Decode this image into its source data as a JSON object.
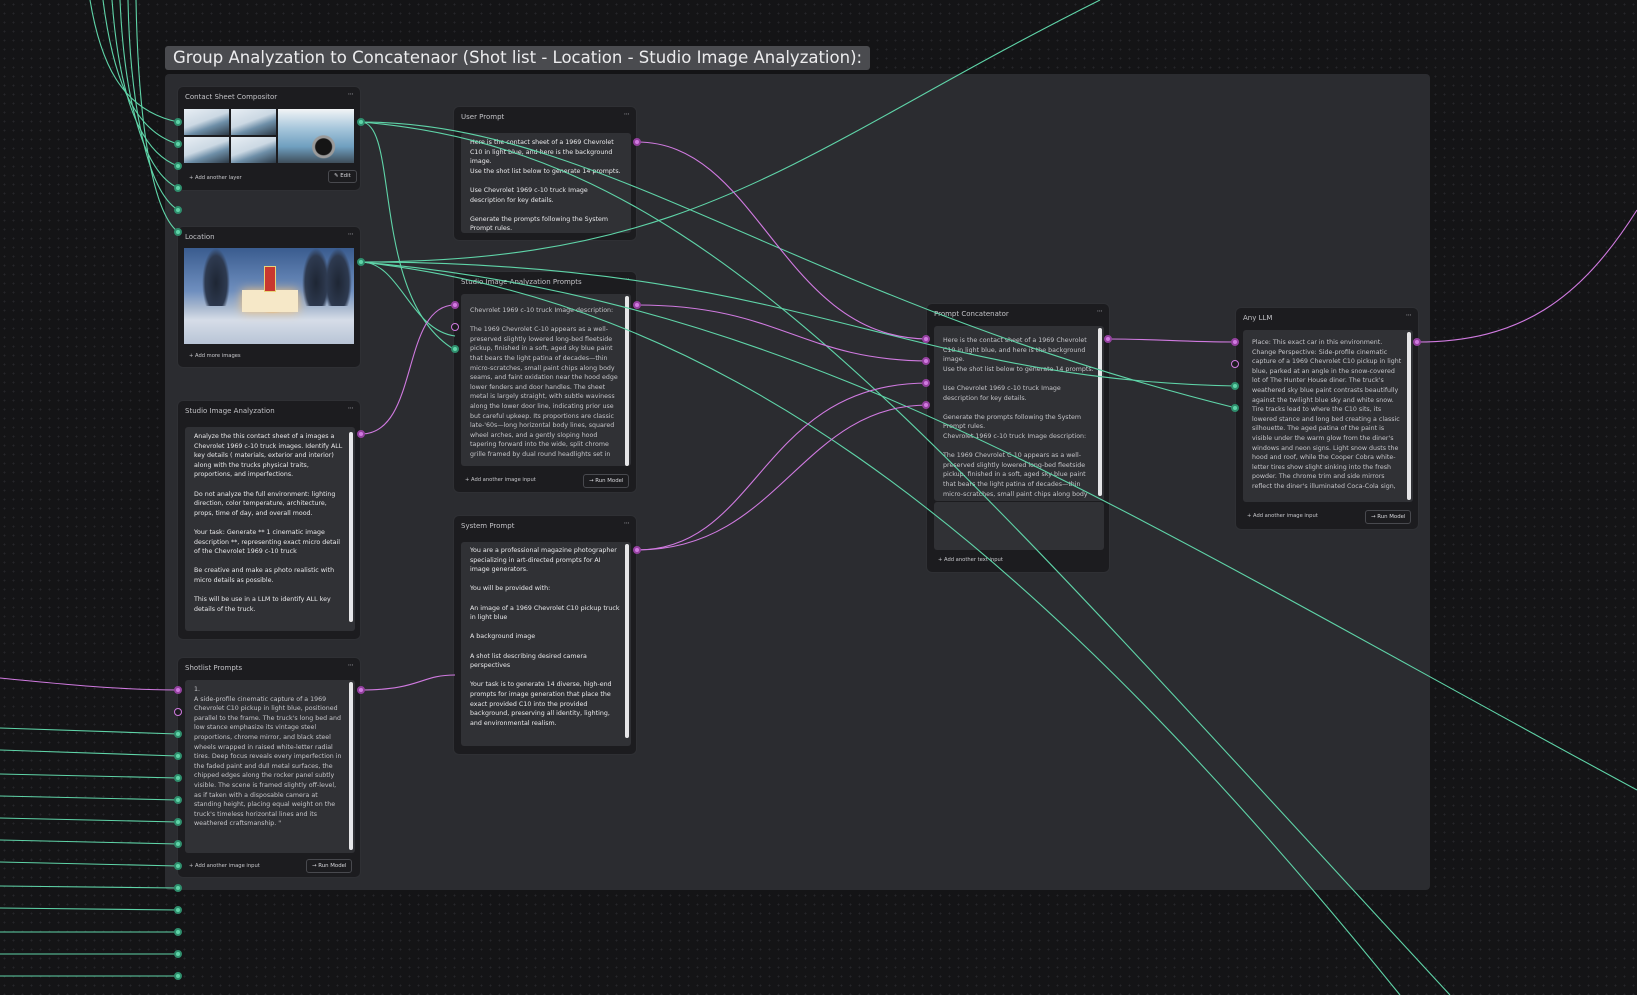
{
  "group": {
    "title": "Group Analyzation to Concatenaor (Shot list - Location - Studio Image Analyzation):"
  },
  "menu_glyph": "···",
  "colors": {
    "canvas": "#141416",
    "group_bg": "#2b2c30",
    "node_bg": "#1c1c1f",
    "wire_image": "#5fd4a8",
    "wire_text": "#d07ae0"
  },
  "nodes": {
    "contact_sheet": {
      "title": "Contact Sheet Compositor",
      "add_link": "+ Add another layer",
      "edit_button": "Edit",
      "edit_icon": "pencil-icon"
    },
    "location": {
      "title": "Location",
      "add_link": "+ Add more images"
    },
    "studio_analysis": {
      "title": "Studio Image Analyzation",
      "paragraphs": [
        "Analyze the this contact sheet of a images a Chevrolet 1969 c-10 truck images. Identify ALL key details ( materials, exterior and interior) along with the trucks physical traits, proportions, and imperfections.",
        "Do not analyze the full environment: lighting direction, color temperature, architecture, props, time of day, and overall mood.",
        "Your task: Generate ** 1 cinematic image description **, representing exact micro detail of the Chevrolet 1969 c-10 truck",
        "Be creative and make as photo realistic with micro details as possible.",
        "This will be use in a LLM to identify ALL key details of the truck."
      ]
    },
    "shotlist": {
      "title": "Shotlist Prompts",
      "paragraphs": [
        "1.\nA side-profile cinematic capture of a 1969 Chevrolet C10 pickup in light blue, positioned parallel to the frame. The truck's long bed and low stance emphasize its vintage steel proportions, chrome mirror, and black steel wheels wrapped in raised white-letter radial tires. Deep focus reveals every imperfection in the faded paint and dull metal surfaces, the chipped edges along the rocker panel subtly visible. The scene is framed slightly off-level, as if taken with a disposable camera at standing height, placing equal weight on the truck's timeless horizontal lines and its weathered craftsmanship. \""
      ],
      "add_link": "+ Add another image input",
      "run_button": "→ Run Model"
    },
    "user_prompt": {
      "title": "User Prompt",
      "paragraphs": [
        "Here is the contact sheet of a 1969 Chevrolet C10 in light blue, and here is the background image.\nUse the shot list below to generate 14 prompts.",
        "Use Chevrolet 1969 c-10 truck Image description for key details.",
        "Generate the prompts following the System Prompt rules."
      ]
    },
    "studio_prompts": {
      "title": "Studio Image Analyzation Prompts",
      "paragraphs": [
        "Chevrolet 1969 c-10 truck Image description:",
        "The 1969 Chevrolet C-10 appears as a well-preserved slightly lowered long-bed fleetside pickup, finished in a soft, aged sky blue paint that bears the light patina of decades—thin micro-scratches, small paint chips along body seams, and faint oxidation near the hood edge lower fenders and door handles. The sheet metal is largely straight, with subtle waviness along the lower door line, indicating prior use but careful upkeep. Its proportions are classic late-'60s—long horizontal body lines, squared wheel arches, and a gently sloping hood tapering forward into the wide, split chrome grille framed by dual round headlights set in"
      ],
      "add_link": "+ Add another image input",
      "run_button": "→ Run Model"
    },
    "system_prompt": {
      "title": "System Prompt",
      "paragraphs": [
        "You are a professional magazine photographer specializing in art-directed prompts for AI image generators.",
        "You will be provided with:",
        "An image of a 1969 Chevrolet C10 pickup truck in light blue",
        "A background image",
        "A shot list describing desired camera perspectives",
        "Your task is to generate 14 diverse, high-end prompts for image generation that place the exact provided C10 into the provided background, preserving all identity, lighting, and environmental realism."
      ]
    },
    "concatenator": {
      "title": "Prompt Concatenator",
      "paragraphs": [
        "Here is the contact sheet of a 1969 Chevrolet C10 in light blue, and here is the background image.\nUse the shot list below to generate 14 prompts.",
        "Use Chevrolet 1969 c-10 truck Image description for key details.",
        "Generate the prompts following the System Prompt rules.\nChevrolet 1969 c-10 truck Image description:",
        "The 1969 Chevrolet C-10 appears as a well-preserved slightly lowered long-bed fleetside pickup, finished in a soft, aged sky blue paint that bears the light patina of decades—thin micro-scratches, small paint chips along body"
      ],
      "add_link": "+ Add another text input"
    },
    "any_llm": {
      "title": "Any LLM",
      "paragraphs": [
        "Place: This exact car in this environment.\nChange Perspective: Side-profile cinematic capture of a 1969 Chevrolet C10 pickup in light blue, parked at an angle in the snow-covered lot of The Hunter House diner. The truck's weathered sky blue paint contrasts beautifully against the twilight blue sky and white snow. Tire tracks lead to where the C10 sits, its lowered stance and long bed creating a classic silhouette. The aged patina of the paint is visible under the warm glow from the diner's windows and neon signs. Light snow dusts the hood and roof, while the Cooper Cobra white-letter tires show slight sinking into the fresh powder. The chrome trim and side mirrors reflect the diner's illuminated Coca-Cola sign,"
      ],
      "add_link": "+ Add another image input",
      "run_button": "→ Run Model"
    }
  }
}
